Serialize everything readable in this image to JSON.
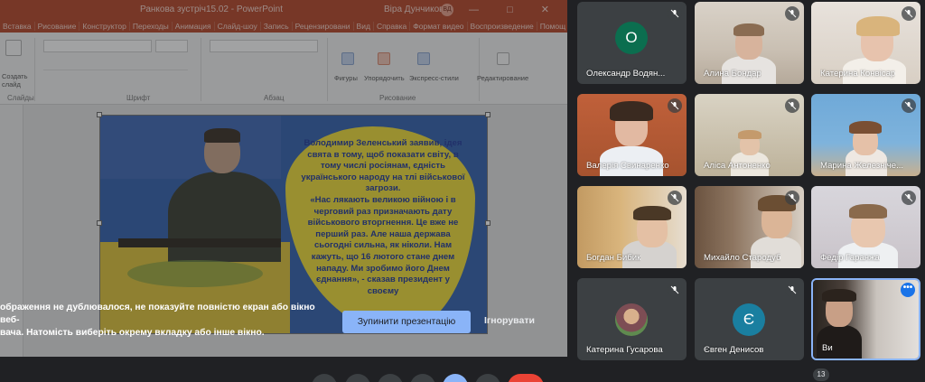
{
  "powerpoint": {
    "window_title": "Ранкова зустріч15.02  -  PowerPoint",
    "user_name": "Віра Дунчикова",
    "user_initials": "ВД",
    "window_controls": "— □ ✕",
    "menu": [
      "Вставка",
      "Рисование",
      "Конструктор",
      "Переходы",
      "Анимация",
      "Слайд-шоу",
      "Запись",
      "Рецензировани",
      "Вид",
      "Справка",
      "Формат видео",
      "Воспроизведение",
      "Помощ"
    ],
    "ribbon_groups": {
      "slides": "Слайды",
      "font": "Шрифт",
      "paragraph": "Абзац",
      "drawing": "Рисование",
      "editing": "Редактирование"
    },
    "ribbon_buttons": {
      "create_slide": "Создать слайд",
      "shapes": "Фигуры",
      "arrange": "Упорядочить",
      "quick_styles": "Экспресс-стили",
      "edit": "Редактирование"
    },
    "slide_text": "Володимир Зеленський заявив, ідея свята в тому, щоб показати світу, в тому числі росіянам, єдність українського народу на тлі військової загрози.\n«Нас лякають великою війною і в черговий раз призначають дату військового вторгнення. Це вже не перший раз. Але наша держава сьогодні сильна, як ніколи. Нам кажуть, що 16 лютого стане днем нападу. Ми зробимо його Днем єднання», - сказав президент у своєму"
  },
  "share_banner": {
    "warning": "ображення не дублювалося, не показуйте повністю екран або вікно веб-\nвача. Натомість виберіть окрему вкладку або інше вікно.",
    "stop_button": "Зупинити презентацію",
    "ignore_button": "Ігнорувати"
  },
  "participants": [
    {
      "name": "Олександр Водян...",
      "initial": "О",
      "color": "#0b6e4f"
    },
    {
      "name": "Алина Бондар"
    },
    {
      "name": "Катерина Конвісар"
    },
    {
      "name": "Валерія Свинаренко"
    },
    {
      "name": "Аліса Антоненко"
    },
    {
      "name": "Марина Железнічe..."
    },
    {
      "name": "Богдан Бибик"
    },
    {
      "name": "Михайло Стародуб"
    },
    {
      "name": "Федір Гаранжа"
    },
    {
      "name": "Катерина Гусарова"
    },
    {
      "name": "Євген Денисов",
      "initial": "Є",
      "color": "#1a7fa0"
    },
    {
      "name": "Ви"
    }
  ],
  "self_menu": "•••",
  "participant_count": "13"
}
